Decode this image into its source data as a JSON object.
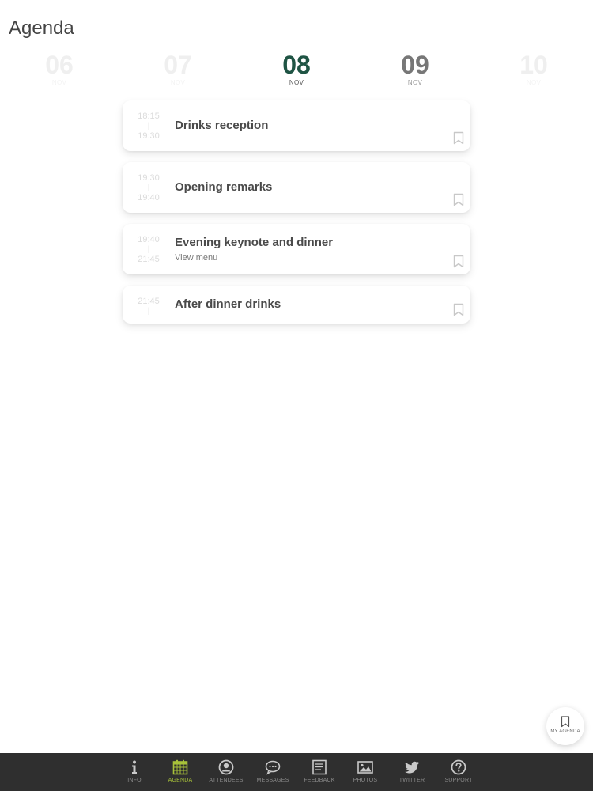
{
  "page": {
    "title": "Agenda"
  },
  "dates": [
    {
      "day": "06",
      "month": "NOV",
      "state": "faded"
    },
    {
      "day": "07",
      "month": "NOV",
      "state": "faded"
    },
    {
      "day": "08",
      "month": "NOV",
      "state": "active"
    },
    {
      "day": "09",
      "month": "NOV",
      "state": "near"
    },
    {
      "day": "10",
      "month": "NOV",
      "state": "faded"
    }
  ],
  "sessions": [
    {
      "start": "18:15",
      "end": "19:30",
      "title": "Drinks reception",
      "subtitle": ""
    },
    {
      "start": "19:30",
      "end": "19:40",
      "title": "Opening remarks",
      "subtitle": ""
    },
    {
      "start": "19:40",
      "end": "21:45",
      "title": "Evening keynote and dinner",
      "subtitle": "View menu"
    },
    {
      "start": "21:45",
      "end": "",
      "title": "After dinner drinks",
      "subtitle": ""
    }
  ],
  "fab": {
    "label": "MY AGENDA",
    "icon": "bookmark-icon"
  },
  "nav": {
    "items": [
      {
        "label": "INFO",
        "icon": "info-icon"
      },
      {
        "label": "AGENDA",
        "icon": "calendar-icon"
      },
      {
        "label": "ATTENDEES",
        "icon": "user-icon"
      },
      {
        "label": "MESSAGES",
        "icon": "chat-icon"
      },
      {
        "label": "FEEDBACK",
        "icon": "feedback-icon"
      },
      {
        "label": "PHOTOS",
        "icon": "photo-icon"
      },
      {
        "label": "TWITTER",
        "icon": "twitter-icon"
      },
      {
        "label": "SUPPORT",
        "icon": "help-icon"
      }
    ],
    "active_index": 1
  },
  "colors": {
    "accent": "#1f5444",
    "nav_active": "#a8c23a",
    "nav_bg": "#2f2f2f"
  }
}
